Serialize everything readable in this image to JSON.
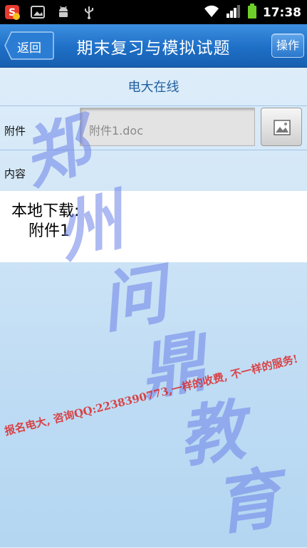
{
  "status_bar": {
    "time": "17:38",
    "icons": [
      "sogou-icon",
      "image-icon",
      "android-icon",
      "usb-icon",
      "wifi-icon",
      "signal-icon",
      "battery-icon"
    ]
  },
  "header": {
    "back_label": "返回",
    "title": "期末复习与模拟试题",
    "action_label": "操作"
  },
  "section": {
    "title": "电大在线"
  },
  "attachment": {
    "label": "附件",
    "value": "附件1.doc"
  },
  "content": {
    "label": "内容",
    "line1": "本地下载:",
    "line2": "附件1"
  },
  "watermark": {
    "chars": [
      "郑",
      "州",
      "问",
      "鼎",
      "教",
      "育"
    ],
    "text": "报名电大, 咨询QQ:2238390773,一样的收费, 不一样的服务!"
  },
  "colors": {
    "titlebar": "#1e6fc6",
    "section_title": "#1f5f9e",
    "watermark_blue": "#6c82e8",
    "watermark_red": "#dc2828"
  }
}
